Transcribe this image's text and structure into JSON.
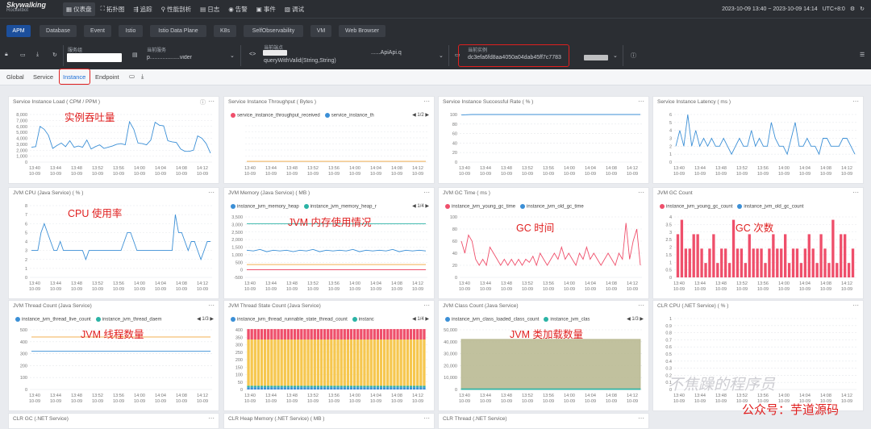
{
  "app": {
    "brand": "Skywalking",
    "brand_sub": "Rocketbot"
  },
  "nav": [
    {
      "label": "仪表盘",
      "icon": "dashboard-icon",
      "active": true
    },
    {
      "label": "拓扑图",
      "icon": "topology-icon"
    },
    {
      "label": "追踪",
      "icon": "trace-icon"
    },
    {
      "label": "性能剖析",
      "icon": "profile-icon"
    },
    {
      "label": "日志",
      "icon": "log-icon"
    },
    {
      "label": "告警",
      "icon": "alarm-icon"
    },
    {
      "label": "事件",
      "icon": "event-icon"
    },
    {
      "label": "调试",
      "icon": "debug-icon"
    }
  ],
  "time_range": "2023-10-09 13:40 ~ 2023-10-09 14:14",
  "timezone": "UTC+8:0",
  "tabs": [
    "APM",
    "Database",
    "Event",
    "Istio",
    "Istio Data Plane",
    "K8s",
    "SelfObservability",
    "VM",
    "Web Browser"
  ],
  "selectors": {
    "service_group_label": "服务组",
    "service_label": "当前服务",
    "service_value": "p...................vider",
    "endpoint_label": "当前端点",
    "endpoint_value": "queryWithValid(String,String)",
    "endpoint_partial": "......ApiApi.q",
    "instance_label": "当前实例",
    "instance_value": "dc3efa6fd8aa4050a04dab45ff7c7783"
  },
  "subnav": [
    "Global",
    "Service",
    "Instance",
    "Endpoint"
  ],
  "annotations": {
    "throughput": "实例吞吐量",
    "cpu": "CPU 使用率",
    "jvm_memory": "JVM 内存使用情况",
    "gc_time": "GC 时间",
    "gc_count": "GC 次数",
    "jvm_thread": "JVM 线程数量",
    "jvm_class": "JVM 类加载数量"
  },
  "x_labels": [
    "13:40",
    "13:44",
    "13:48",
    "13:52",
    "13:56",
    "14:00",
    "14:04",
    "14:08",
    "14:12"
  ],
  "x_date": "10-09",
  "watermark": "不焦躁的程序员",
  "watermark2": "公众号：芋道源码",
  "colors": {
    "blue": "#3b8fd6",
    "red": "#ef4f6b",
    "orange": "#f0a43a",
    "teal": "#2bb3a5",
    "yellow": "#f6c74f",
    "olive": "#b6b68d",
    "accent": "#1c4f9c"
  },
  "panels": [
    {
      "id": "load",
      "title": "Service Instance Load ( CPM / PPM )",
      "legend": [],
      "chart_data": {
        "type": "line",
        "ylim": [
          0,
          8000
        ],
        "yticks": [
          "8,000",
          "7,000",
          "6,000",
          "5,000",
          "4,000",
          "3,000",
          "2,000",
          "1,000",
          "0"
        ],
        "series": [
          {
            "color": "blue",
            "values": [
              2500,
              2600,
              6000,
              5500,
              4500,
              2300,
              2800,
              3200,
              2600,
              3600,
              2500,
              2700,
              2500,
              3700,
              2200,
              2600,
              2900,
              2300,
              2500,
              2700,
              3000,
              3100,
              2900,
              6800,
              5500,
              3200,
              3100,
              2900,
              3700,
              6700,
              6200,
              6100,
              3600,
              3400,
              3300,
              2200,
              1800,
              1800,
              2000,
              4400,
              4000,
              3100,
              1500
            ]
          }
        ]
      }
    },
    {
      "id": "throughput",
      "title": "Service Instance Throughput ( Bytes )",
      "legend": [
        {
          "name": "service_instance_throughput_received",
          "color": "red"
        },
        {
          "name": "service_instance_th",
          "color": "blue"
        }
      ],
      "pager": "1/2",
      "chart_data": {
        "type": "line",
        "ylim": [
          0,
          1
        ],
        "yticks": [
          "",
          "",
          "",
          "",
          "",
          "",
          ""
        ],
        "series": [
          {
            "color": "orange",
            "values": [
              0.02,
              0.02
            ]
          }
        ]
      }
    },
    {
      "id": "success",
      "title": "Service Instance Successful Rate ( % )",
      "legend": [],
      "chart_data": {
        "type": "line",
        "ylim": [
          0,
          100
        ],
        "yticks": [
          "100",
          "80",
          "60",
          "40",
          "20",
          "0"
        ],
        "series": [
          {
            "color": "blue",
            "values": [
              99,
              100,
              100,
              100,
              100,
              100,
              100,
              100,
              100,
              100,
              100,
              100,
              100,
              100,
              100,
              100,
              100,
              100
            ]
          }
        ]
      }
    },
    {
      "id": "latency",
      "title": "Service Instance Latency ( ms )",
      "legend": [],
      "chart_data": {
        "type": "line",
        "ylim": [
          0,
          6
        ],
        "yticks": [
          "6",
          "5",
          "4",
          "3",
          "2",
          "1",
          "0"
        ],
        "series": [
          {
            "color": "blue",
            "values": [
              2,
              4,
              2,
              6,
              2,
              4,
              2,
              3,
              2,
              3,
              2,
              2,
              3,
              2,
              1,
              2,
              3,
              2,
              2,
              4,
              2,
              3,
              2,
              2,
              5,
              3,
              2,
              2,
              1,
              3,
              5,
              2,
              2,
              3,
              2,
              2,
              1,
              3,
              3,
              2,
              2,
              2,
              3,
              3,
              2,
              1
            ]
          }
        ]
      }
    },
    {
      "id": "cpu",
      "title": "JVM CPU (Java Service) ( % )",
      "legend": [],
      "chart_data": {
        "type": "line",
        "ylim": [
          0,
          8
        ],
        "yticks": [
          "8",
          "7",
          "6",
          "5",
          "4",
          "3",
          "2",
          "1",
          "0"
        ],
        "series": [
          {
            "color": "blue",
            "values": [
              3,
              3,
              3,
              5,
              6,
              5,
              4,
              3,
              3,
              4,
              3,
              3,
              3,
              3,
              3,
              3,
              3,
              2,
              3,
              3,
              3,
              3,
              3,
              3,
              3,
              3,
              3,
              3,
              3,
              4,
              5,
              5,
              4,
              3,
              3,
              3,
              3,
              3,
              3,
              3,
              3,
              3,
              3,
              3,
              3,
              7,
              5,
              5,
              4,
              3,
              4,
              4,
              3,
              2,
              3,
              4,
              4
            ]
          }
        ]
      }
    },
    {
      "id": "memory",
      "title": "JVM Memory (Java Service) ( MB )",
      "legend": [
        {
          "name": "instance_jvm_memory_heap",
          "color": "blue"
        },
        {
          "name": "instance_jvm_memory_heap_r",
          "color": "teal"
        }
      ],
      "pager": "1/4",
      "chart_data": {
        "type": "line",
        "ylim": [
          -500,
          3500
        ],
        "yticks": [
          "3,500",
          "3,000",
          "2,500",
          "2,000",
          "1,500",
          "1,000",
          "500",
          "0",
          "-500"
        ],
        "series": [
          {
            "color": "teal",
            "values": [
              3050,
              3050
            ]
          },
          {
            "color": "blue",
            "values": [
              1300,
              1250,
              1350,
              1200,
              1300,
              1250,
              1300,
              1200,
              1300,
              1250,
              1350,
              1200,
              1300,
              1250,
              1300,
              1250,
              1350,
              1200,
              1300,
              1250,
              1300,
              1250,
              1350,
              1200,
              1300,
              1250,
              1300,
              1250
            ]
          },
          {
            "color": "orange",
            "values": [
              350,
              350
            ]
          },
          {
            "color": "red",
            "values": [
              5,
              5
            ]
          }
        ]
      }
    },
    {
      "id": "gctime",
      "title": "JVM GC Time ( ms )",
      "legend": [
        {
          "name": "instance_jvm_young_gc_time",
          "color": "red"
        },
        {
          "name": "instance_jvm_old_gc_time",
          "color": "blue"
        }
      ],
      "chart_data": {
        "type": "line",
        "ylim": [
          0,
          100
        ],
        "yticks": [
          "100",
          "80",
          "60",
          "40",
          "20",
          "0"
        ],
        "series": [
          {
            "color": "red",
            "values": [
              60,
              40,
              70,
              60,
              30,
              20,
              30,
              20,
              50,
              40,
              30,
              20,
              30,
              20,
              30,
              20,
              30,
              20,
              30,
              25,
              35,
              20,
              40,
              30,
              20,
              30,
              40,
              30,
              50,
              30,
              40,
              30,
              20,
              40,
              30,
              50,
              30,
              40,
              30,
              20,
              30,
              40,
              30,
              20,
              40,
              30,
              90,
              30,
              60,
              80,
              20
            ]
          }
        ]
      }
    },
    {
      "id": "gccount",
      "title": "JVM GC Count",
      "legend": [
        {
          "name": "instance_jvm_young_gc_count",
          "color": "red"
        },
        {
          "name": "instance_jvm_old_gc_count",
          "color": "blue"
        }
      ],
      "chart_data": {
        "type": "bar",
        "ylim": [
          0,
          4.2
        ],
        "yticks": [
          "4",
          "3.5",
          "3",
          "2.5",
          "2",
          "1.5",
          "1",
          "0.5",
          "0"
        ],
        "series": [
          {
            "color": "red",
            "values": [
              3,
              4,
              2,
              2,
              3,
              3,
              2,
              1,
              2,
              3,
              1,
              2,
              2,
              1,
              4,
              2,
              2,
              1,
              3,
              2,
              2,
              2,
              1,
              2,
              3,
              2,
              2,
              3,
              1,
              2,
              2,
              1,
              2,
              3,
              2,
              1,
              3,
              2,
              1,
              4,
              1,
              3,
              3,
              1,
              2
            ]
          }
        ]
      }
    },
    {
      "id": "thread",
      "title": "JVM Thread Count (Java Service)",
      "legend": [
        {
          "name": "instance_jvm_thread_live_count",
          "color": "blue"
        },
        {
          "name": "instance_jvm_thread_daem",
          "color": "teal"
        }
      ],
      "pager": "1/3",
      "chart_data": {
        "type": "line",
        "ylim": [
          0,
          500
        ],
        "yticks": [
          "500",
          "400",
          "300",
          "200",
          "100",
          "0"
        ],
        "series": [
          {
            "color": "orange",
            "values": [
              440,
              440
            ]
          },
          {
            "color": "blue",
            "values": [
              320,
              320
            ]
          }
        ]
      }
    },
    {
      "id": "threadstate",
      "title": "JVM Thread State Count (Java Service)",
      "legend": [
        {
          "name": "instance_jvm_thread_runnable_state_thread_count",
          "color": "blue"
        },
        {
          "name": "instanc",
          "color": "teal"
        }
      ],
      "pager": "1/4",
      "chart_data": {
        "type": "stacked-bar",
        "ylim": [
          0,
          400
        ],
        "yticks": [
          "400",
          "350",
          "300",
          "250",
          "200",
          "150",
          "100",
          "50",
          "0"
        ],
        "bars": 54,
        "stack": [
          {
            "color": "blue",
            "value": 15
          },
          {
            "color": "teal",
            "value": 10
          },
          {
            "color": "yellow",
            "value": 310
          },
          {
            "color": "red",
            "value": 70
          }
        ]
      }
    },
    {
      "id": "classcount",
      "title": "JVM Class Count (Java Service)",
      "legend": [
        {
          "name": "instance_jvm_class_loaded_class_count",
          "color": "blue"
        },
        {
          "name": "instance_jvm_clas",
          "color": "teal"
        }
      ],
      "pager": "1/3",
      "chart_data": {
        "type": "area",
        "ylim": [
          0,
          50000
        ],
        "yticks": [
          "50,000",
          "40,000",
          "30,000",
          "20,000",
          "10,000",
          "0"
        ],
        "series": [
          {
            "color": "olive",
            "values": [
              42000,
              42000
            ]
          },
          {
            "color": "teal",
            "values": [
              600,
              600
            ]
          }
        ]
      }
    },
    {
      "id": "clrcpu",
      "title": "CLR CPU (.NET Service) ( % )",
      "legend": [],
      "chart_data": {
        "type": "line",
        "ylim": [
          0,
          1
        ],
        "yticks": [
          "1",
          "0.9",
          "0.8",
          "0.7",
          "0.6",
          "0.5",
          "0.4",
          "0.3",
          "0.2",
          "0.1",
          "0"
        ],
        "series": []
      }
    }
  ],
  "bottom_panels": [
    "CLR GC (.NET Service)",
    "CLR Heap Memory (.NET Service) ( MB )",
    "CLR Thread (.NET Service)"
  ]
}
